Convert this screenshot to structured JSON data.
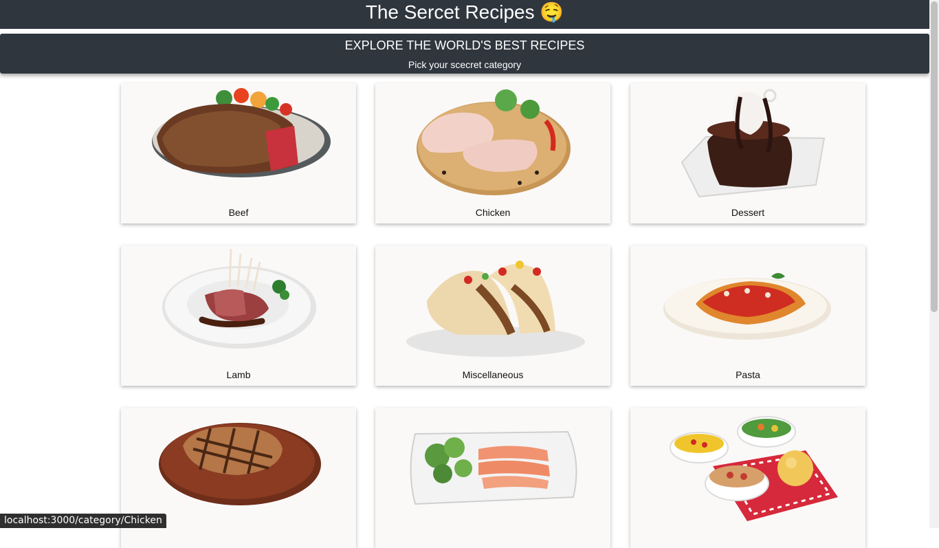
{
  "header": {
    "title": "The Sercet Recipes",
    "emoji": "🤤"
  },
  "banner": {
    "heading": "EXPLORE THE WORLD'S BEST RECIPES",
    "subheading": "Pick your scecret category"
  },
  "categories": [
    {
      "label": "Beef",
      "icon": "steak-plate-image"
    },
    {
      "label": "Chicken",
      "icon": "raw-chicken-image"
    },
    {
      "label": "Dessert",
      "icon": "chocolate-cake-image"
    },
    {
      "label": "Lamb",
      "icon": "lamb-chops-image"
    },
    {
      "label": "Miscellaneous",
      "icon": "tacos-image"
    },
    {
      "label": "Pasta",
      "icon": "penne-pasta-image"
    },
    {
      "label": "",
      "icon": "pork-chop-image"
    },
    {
      "label": "",
      "icon": "salmon-plate-image"
    },
    {
      "label": "",
      "icon": "side-dishes-image"
    }
  ],
  "status": {
    "url": "localhost:3000/category/Chicken"
  }
}
